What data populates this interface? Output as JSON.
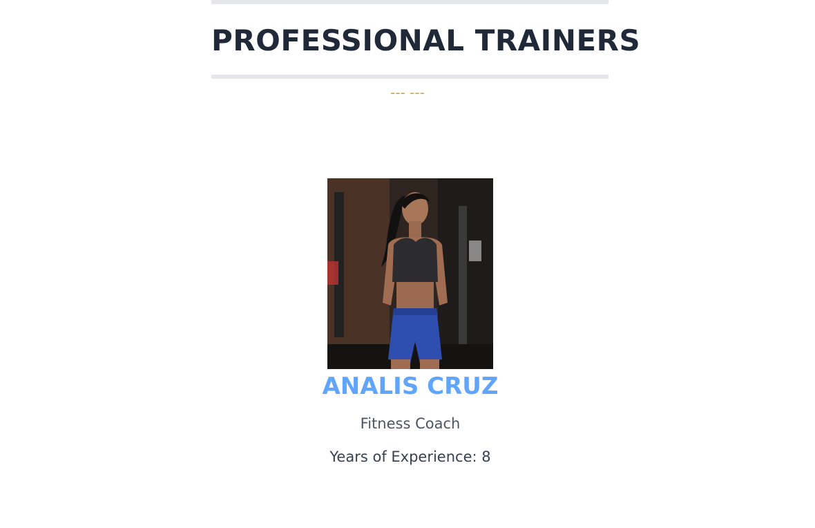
{
  "header": {
    "title": "PROFESSIONAL TRAINERS",
    "divider": "--- ---"
  },
  "trainer": {
    "name": "ANALIS CRUZ",
    "role": "Fitness Coach",
    "experience": "Years of Experience: 8",
    "photo_icon": "trainer-photo"
  },
  "colors": {
    "title": "#1f2937",
    "accent_dashes": "#d4a24c",
    "name": "#60a5fa",
    "rule": "#e5e7eb"
  }
}
